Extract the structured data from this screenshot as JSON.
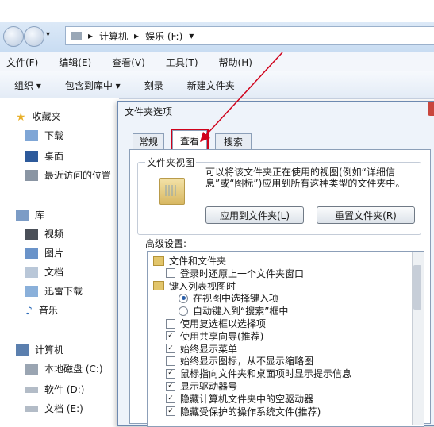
{
  "address": {
    "parts": [
      "▸",
      "计算机",
      "▸",
      "娱乐 (F:)",
      "▾"
    ]
  },
  "menu": [
    "文件(F)",
    "编辑(E)",
    "查看(V)",
    "工具(T)",
    "帮助(H)"
  ],
  "toolbar": [
    "组织 ▾",
    "包含到库中 ▾",
    "刻录",
    "新建文件夹"
  ],
  "sidebar": {
    "favorites": "收藏夹",
    "fav_items": [
      "下载",
      "桌面",
      "最近访问的位置"
    ],
    "libraries": "库",
    "lib_items": [
      "视频",
      "图片",
      "文档",
      "迅雷下载",
      "音乐"
    ],
    "computer": "计算机",
    "drives": [
      "本地磁盘 (C:)",
      "软件 (D:)",
      "文档 (E:)"
    ]
  },
  "dialog": {
    "title": "文件夹选项",
    "tabs": [
      "常规",
      "查看",
      "搜索"
    ],
    "group_title": "文件夹视图",
    "desc": "可以将该文件夹正在使用的视图(例如“详细信息”或“图标”)应用到所有这种类型的文件夹中。",
    "btn_apply": "应用到文件夹(L)",
    "btn_reset": "重置文件夹(R)",
    "advanced_label": "高级设置:",
    "tree": [
      {
        "type": "folder",
        "label": "文件和文件夹"
      },
      {
        "type": "check",
        "checked": false,
        "label": "登录时还原上一个文件夹窗口"
      },
      {
        "type": "folder",
        "label": "键入列表视图时"
      },
      {
        "type": "radio",
        "checked": true,
        "label": "在视图中选择键入项"
      },
      {
        "type": "radio",
        "checked": false,
        "label": "自动键入到“搜索”框中"
      },
      {
        "type": "check",
        "checked": false,
        "label": "使用复选框以选择项"
      },
      {
        "type": "check",
        "checked": true,
        "label": "使用共享向导(推荐)"
      },
      {
        "type": "check",
        "checked": true,
        "label": "始终显示菜单"
      },
      {
        "type": "check",
        "checked": false,
        "label": "始终显示图标，从不显示缩略图"
      },
      {
        "type": "check",
        "checked": true,
        "label": "鼠标指向文件夹和桌面项时显示提示信息"
      },
      {
        "type": "check",
        "checked": true,
        "label": "显示驱动器号"
      },
      {
        "type": "check",
        "checked": true,
        "label": "隐藏计算机文件夹中的空驱动器"
      },
      {
        "type": "check",
        "checked": true,
        "label": "隐藏受保护的操作系统文件(推荐)"
      }
    ]
  }
}
